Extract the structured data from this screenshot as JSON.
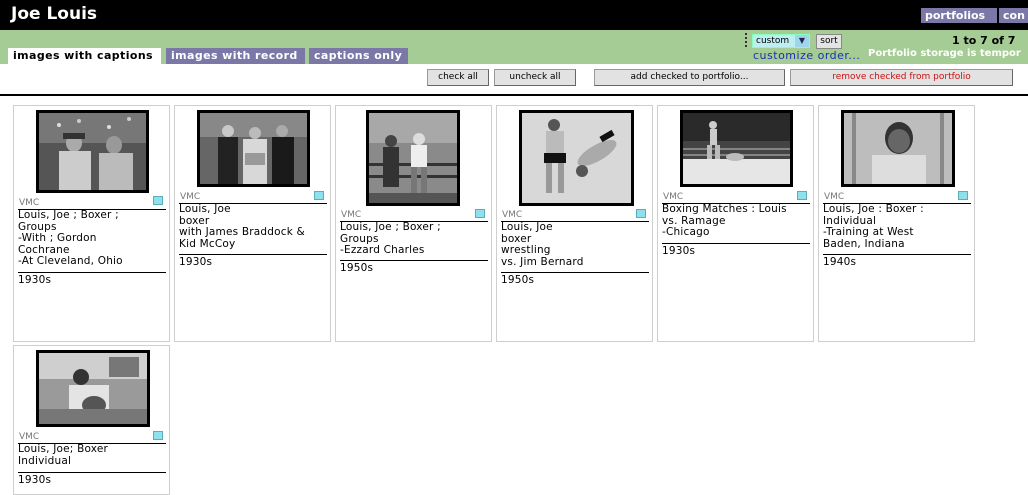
{
  "header": {
    "title": "Joe Louis",
    "nav": {
      "portfolios": "portfolios",
      "con": "con"
    }
  },
  "tabs": [
    {
      "label": "images with captions",
      "active": true
    },
    {
      "label": "images with record",
      "active": false
    },
    {
      "label": "captions only",
      "active": false
    }
  ],
  "toolbar": {
    "sort_select_value": "custom",
    "sort_button": "sort",
    "customize_link": "customize order...",
    "pager": "1 to 7  of  7",
    "storage_note": "Portfolio storage is tempor"
  },
  "actions": {
    "check_all": "check all",
    "uncheck_all": "uncheck all",
    "add_checked": "add checked to portfolio...",
    "remove_checked": "remove checked from portfolio"
  },
  "colors": {
    "title_bar": "#000000",
    "tab_bar": "#a6cc96",
    "tab_inactive": "#7b78a8",
    "checkbox": "#8ee0ec",
    "remove_text": "#cc1111",
    "link": "#1a2fb0"
  },
  "cards": [
    {
      "source": "VMC",
      "caption": [
        "Louis, Joe ; Boxer ;",
        "Groups",
        "-With ; Gordon",
        "Cochrane",
        "-At Cleveland, Ohio"
      ],
      "date": "1930s",
      "image": "boxer-with-men-photo"
    },
    {
      "source": "VMC",
      "caption": [
        "Louis, Joe",
        "boxer",
        "with James Braddock &",
        "Kid McCoy"
      ],
      "date": "1930s",
      "image": "three-men-photo"
    },
    {
      "source": "VMC",
      "caption": [
        "Louis, Joe ; Boxer ;",
        "Groups",
        "-Ezzard Charles"
      ],
      "date": "1950s",
      "image": "ring-group-photo"
    },
    {
      "source": "VMC",
      "caption": [
        "Louis, Joe",
        "boxer",
        "wrestling",
        "vs. Jim Bernard"
      ],
      "date": "1950s",
      "image": "wrestling-photo"
    },
    {
      "source": "VMC",
      "caption": [
        "Boxing Matches : Louis",
        "vs. Ramage",
        "-Chicago"
      ],
      "date": "1930s",
      "image": "boxing-match-photo"
    },
    {
      "source": "VMC",
      "caption": [
        "Louis, Joe : Boxer :",
        "Individual",
        "-Training at West",
        "Baden, Indiana"
      ],
      "date": "1940s",
      "image": "training-portrait-photo"
    },
    {
      "source": "VMC",
      "caption": [
        "Louis, Joe; Boxer",
        "Individual"
      ],
      "date": "1930s",
      "image": "seated-portrait-photo"
    }
  ]
}
